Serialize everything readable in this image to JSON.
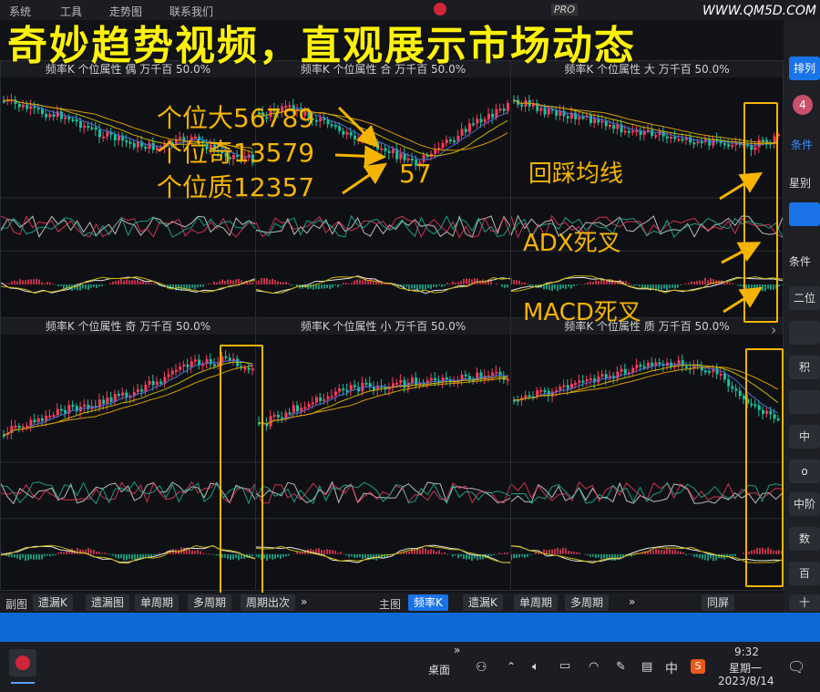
{
  "menu": {
    "items": [
      "系统",
      "工具",
      "走势图",
      "联系我们"
    ]
  },
  "watermark": "WWW.QM5D.COM",
  "banner": "奇妙趋势视频，直观展示市场动态",
  "pro_badge": "PRO",
  "right_panel": {
    "btn_top": "排列",
    "badge": "4",
    "filter": "条件",
    "label_star": "星别",
    "label_cond": "条件",
    "items": [
      "二位",
      "",
      "积",
      "",
      "中",
      "o",
      "中阶",
      "数",
      "百",
      "十"
    ]
  },
  "panels": {
    "top": [
      {
        "header": "频率K  个位属性  偶  万千百  50.0%"
      },
      {
        "header": "频率K  个位属性  合  万千百  50.0%"
      },
      {
        "header": "频率K  个位属性  大  万千百  50.0%"
      }
    ],
    "bottom": [
      {
        "header": "频率K  个位属性  奇  万千百  50.0%"
      },
      {
        "header": "频率K  个位属性  小  万千百  50.0%"
      },
      {
        "header": "频率K  个位属性  质  万千百  50.0%"
      }
    ]
  },
  "annotations": {
    "big": "个位大56789",
    "odd": "个位奇13579",
    "prime": "个位质12357",
    "num": "57",
    "pullback": "回踩均线",
    "adx": "ADX死叉",
    "macd": "MACD死叉"
  },
  "bottom_tabs": {
    "left": [
      "副图",
      "遗漏K",
      "遗漏图",
      "单周期",
      "多周期",
      "周期出次"
    ],
    "right": [
      "主图",
      "频率K",
      "遗漏K",
      "单周期",
      "多周期"
    ],
    "more": "»",
    "same_screen": "同屏"
  },
  "taskbar": {
    "desktop": "桌面",
    "time": "9:32",
    "weekday": "星期一",
    "date": "2023/8/14",
    "ime": "中",
    "sogou": "S"
  },
  "colors": {
    "accent": "#f5b400",
    "banner": "#fff10a",
    "up": "#ff3b5c",
    "down": "#19c3a0",
    "active": "#1a73e8"
  }
}
